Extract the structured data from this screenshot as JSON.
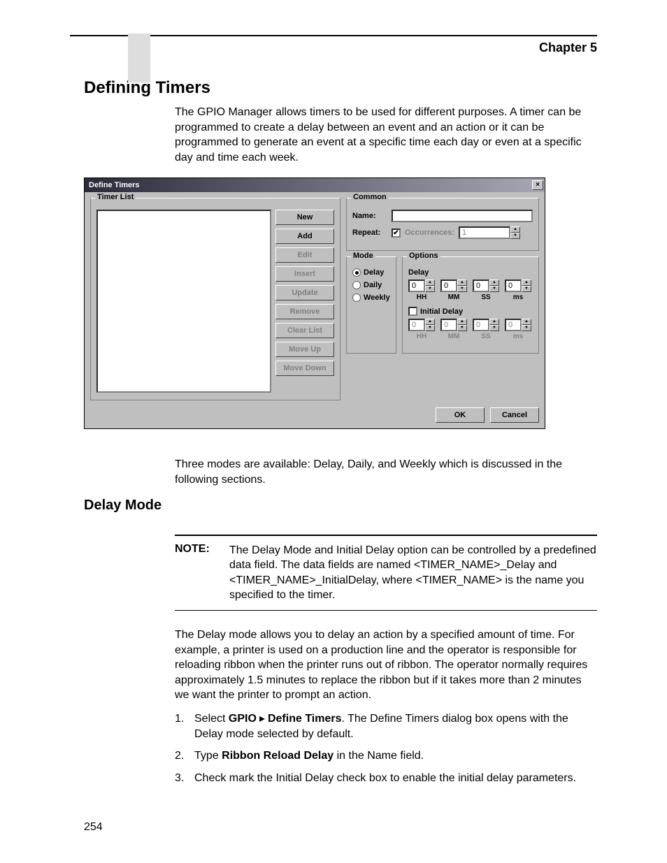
{
  "page": {
    "chapter": "Chapter 5",
    "page_number": "254",
    "section_title": "Defining Timers",
    "sub_title": "Delay Mode",
    "intro": "The GPIO Manager allows timers to be used for different purposes. A timer can be programmed to create a delay between an event and an action or it can be programmed to generate an event at a specific time each day or even at a specific day and time each week.",
    "modes_text": "Three modes are available: Delay, Daily, and Weekly which is discussed in the following sections.",
    "note_label": "NOTE:",
    "note_text": "The Delay Mode and Initial Delay option can be controlled by a predefined data field. The data fields are named <TIMER_NAME>_Delay and <TIMER_NAME>_InitialDelay, where <TIMER_NAME> is the name you specified to the timer.",
    "delay_intro": "The Delay mode allows you to delay an action by a specified amount of time. For example, a printer is used on a production line and the operator is responsible for reloading ribbon when the printer runs out of ribbon. The operator normally requires approximately 1.5 minutes to replace the ribbon but if it takes more than 2 minutes we want the printer to prompt an action.",
    "steps": [
      {
        "num": "1.",
        "pre": "Select ",
        "menu1": "GPIO",
        "menu2": "Define Timers",
        "post": ". The Define Timers dialog box opens with the Delay mode selected by default."
      },
      {
        "num": "2.",
        "pre": "Type ",
        "bold": "Ribbon Reload Delay",
        "post": " in the Name field."
      },
      {
        "num": "3.",
        "text": "Check mark the Initial Delay check box to enable the initial delay parameters."
      }
    ]
  },
  "dialog": {
    "title": "Define Timers",
    "close": "×",
    "timer_list": {
      "legend": "Timer List",
      "buttons": {
        "new": "New",
        "add": "Add",
        "edit": "Edit",
        "insert": "Insert",
        "update": "Update",
        "remove": "Remove",
        "clear": "Clear List",
        "moveup": "Move Up",
        "movedown": "Move Down"
      }
    },
    "common": {
      "legend": "Common",
      "name_label": "Name:",
      "name_value": "",
      "repeat_label": "Repeat:",
      "occurrences_label": "Occurrences:",
      "occurrences_value": "1"
    },
    "mode": {
      "legend": "Mode",
      "delay": "Delay",
      "daily": "Daily",
      "weekly": "Weekly"
    },
    "options": {
      "legend": "Options",
      "delay_label": "Delay",
      "initial_delay_label": "Initial Delay",
      "hh": "HH",
      "mm": "MM",
      "ss": "SS",
      "ms": "ms",
      "delay_vals": {
        "hh": "0",
        "mm": "0",
        "ss": "0",
        "ms": "0"
      },
      "initial_vals": {
        "hh": "0",
        "mm": "0",
        "ss": "0",
        "ms": "0"
      }
    },
    "footer": {
      "ok": "OK",
      "cancel": "Cancel"
    }
  }
}
